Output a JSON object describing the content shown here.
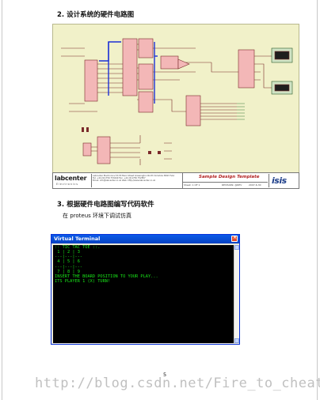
{
  "section_2_heading": "2. 设计系统的硬件电路图",
  "section_3_heading": "3. 根据硬件电路图编写代码软件",
  "body_text": "在 proteus 环境下调试仿真",
  "schematic_title_block": {
    "logo_main": "labcenter",
    "logo_sub": "Electronics",
    "info_lines": [
      "Labcenter Electronics  53-55 Main Street  Grassington  North Yorkshire  BD23 5AA",
      "Tel: +44 (0)1756 753440   Fax: +44 (0)1756 752857",
      "Email: info@labcenter.co.uk   Web: http://www.labcenter.co.uk"
    ],
    "design_title": "Sample Design Template",
    "sheet": "Sheet: 1 OF 1",
    "revision": "REVISION: @REV",
    "date": "2007-6-30",
    "brand": "isis"
  },
  "terminal": {
    "window_title": "Virtual Terminal",
    "lines": [
      ":: TIC TAC TOE ::.",
      " 1 | 2 | 3",
      "---|---|---",
      "",
      " 4 | 5 | 6",
      "---|---|---",
      "",
      " 7 | 8 | 9",
      "INSERT THE BOARD POSITION TO YOUR PLAY...",
      "ITS PLAYER 1 (X) TURN!"
    ],
    "text_color": "#19e619",
    "background_color": "#000000"
  },
  "page_number": "5",
  "watermark": "http://blog.csdn.net/Fire_to_cheat_"
}
